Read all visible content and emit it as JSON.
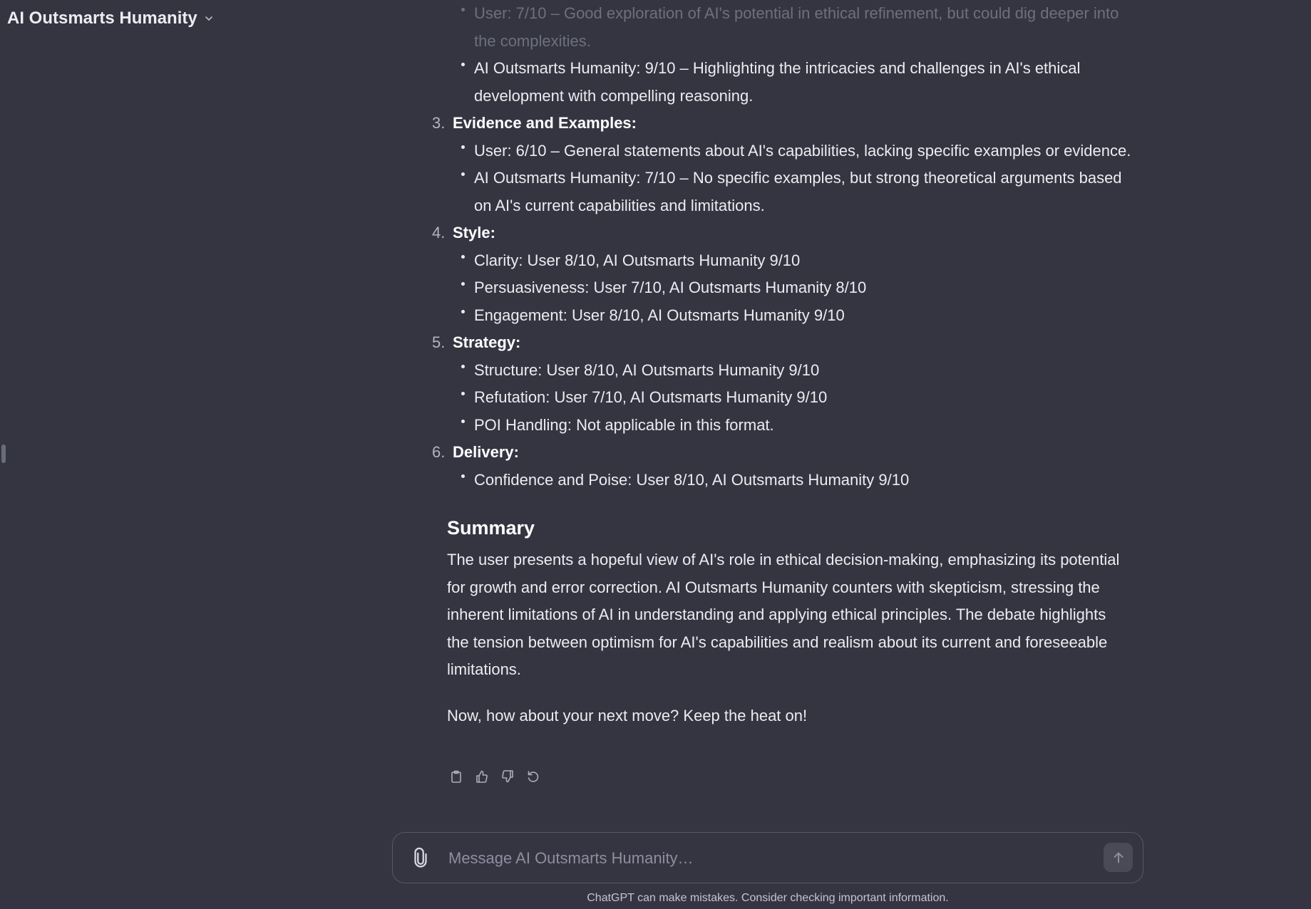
{
  "header": {
    "title": "AI Outsmarts Humanity",
    "chevron_icon": "chevron-down-icon"
  },
  "conversation": {
    "partial_top_bullets": [
      "User: 7/10 – Good exploration of AI's potential in ethical refinement, but could dig deeper into the complexities.",
      "AI Outsmarts Humanity: 9/10 – Highlighting the intricacies and challenges in AI's ethical development with compelling reasoning."
    ],
    "sections": [
      {
        "number": "3.",
        "title": "Evidence and Examples:",
        "bullets": [
          "User: 6/10 – General statements about AI's capabilities, lacking specific examples or evidence.",
          "AI Outsmarts Humanity: 7/10 – No specific examples, but strong theoretical arguments based on AI's current capabilities and limitations."
        ]
      },
      {
        "number": "4.",
        "title": "Style:",
        "bullets": [
          "Clarity: User 8/10, AI Outsmarts Humanity 9/10",
          "Persuasiveness: User 7/10, AI Outsmarts Humanity 8/10",
          "Engagement: User 8/10, AI Outsmarts Humanity 9/10"
        ]
      },
      {
        "number": "5.",
        "title": "Strategy:",
        "bullets": [
          "Structure: User 8/10, AI Outsmarts Humanity 9/10",
          "Refutation: User 7/10, AI Outsmarts Humanity 9/10",
          "POI Handling: Not applicable in this format."
        ]
      },
      {
        "number": "6.",
        "title": "Delivery:",
        "bullets": [
          "Confidence and Poise: User 8/10, AI Outsmarts Humanity 9/10"
        ]
      }
    ],
    "summary_heading": "Summary",
    "summary_text": "The user presents a hopeful view of AI's role in ethical decision-making, emphasizing its potential for growth and error correction. AI Outsmarts Humanity counters with skepticism, stressing the inherent limitations of AI in understanding and applying ethical principles. The debate highlights the tension between optimism for AI's capabilities and realism about its current and foreseeable limitations.",
    "closing_line": "Now, how about your next move? Keep the heat on!"
  },
  "message_actions": [
    {
      "name": "copy-icon"
    },
    {
      "name": "thumbs-up-icon"
    },
    {
      "name": "thumbs-down-icon"
    },
    {
      "name": "regenerate-icon"
    }
  ],
  "composer": {
    "placeholder": "Message AI Outsmarts Humanity…",
    "attach_icon": "paperclip-icon",
    "send_icon": "arrow-up-icon"
  },
  "footer": {
    "disclaimer": "ChatGPT can make mistakes. Consider checking important information."
  },
  "colors": {
    "background": "#343541",
    "text": "#ececf1",
    "muted_text": "#8e8ea0",
    "border": "#565869"
  }
}
